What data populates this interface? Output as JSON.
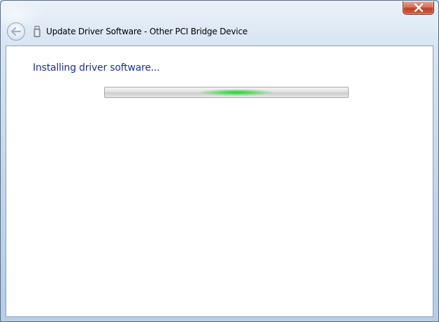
{
  "window": {
    "title": "Update Driver Software - Other PCI Bridge Device",
    "close_icon": "close-icon",
    "back_icon": "back-arrow-icon",
    "device_icon": "usb-device-icon"
  },
  "page": {
    "heading": "Installing driver software..."
  },
  "progress": {
    "state": "indeterminate",
    "glow_position": 0.54,
    "glow_color": "#1ed228"
  },
  "colors": {
    "heading": "#1e3287",
    "content_background": "#ffffff",
    "frame": "#c9dcef"
  }
}
